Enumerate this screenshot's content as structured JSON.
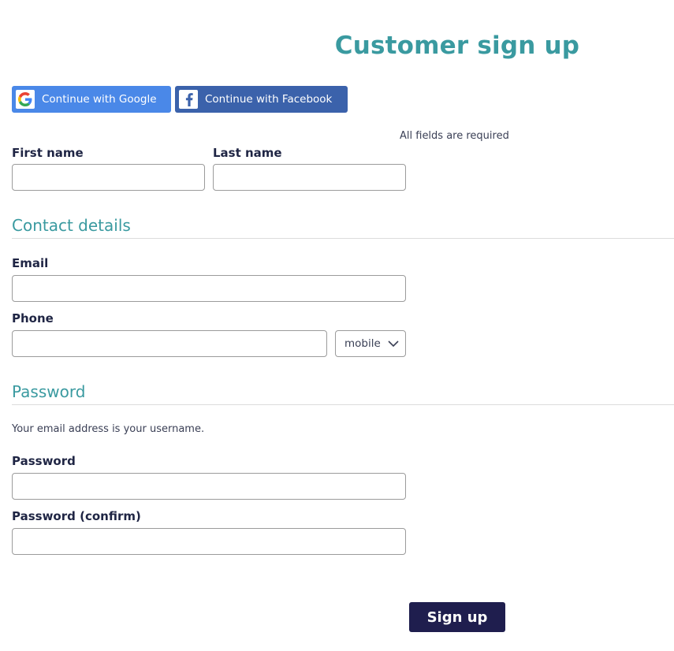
{
  "page": {
    "title": "Customer sign up",
    "required_note": "All fields are required"
  },
  "social": {
    "google_label": "Continue with Google",
    "facebook_label": "Continue with Facebook",
    "google_icon": "google-g-icon",
    "facebook_icon": "facebook-f-icon"
  },
  "name_fields": {
    "first_name_label": "First name",
    "first_name_value": "",
    "last_name_label": "Last name",
    "last_name_value": ""
  },
  "contact": {
    "heading": "Contact details",
    "email_label": "Email",
    "email_value": "",
    "phone_label": "Phone",
    "phone_value": "",
    "phone_type_selected": "mobile"
  },
  "password": {
    "heading": "Password",
    "hint": "Your email address is your username.",
    "password_label": "Password",
    "password_value": "",
    "confirm_label": "Password (confirm)",
    "confirm_value": ""
  },
  "actions": {
    "submit_label": "Sign up"
  },
  "colors": {
    "accent": "#3a9aa0",
    "google_blue": "#4a88e8",
    "facebook_blue": "#3b62ab",
    "submit_navy": "#1f1e4e",
    "label_text": "#1f2544"
  }
}
